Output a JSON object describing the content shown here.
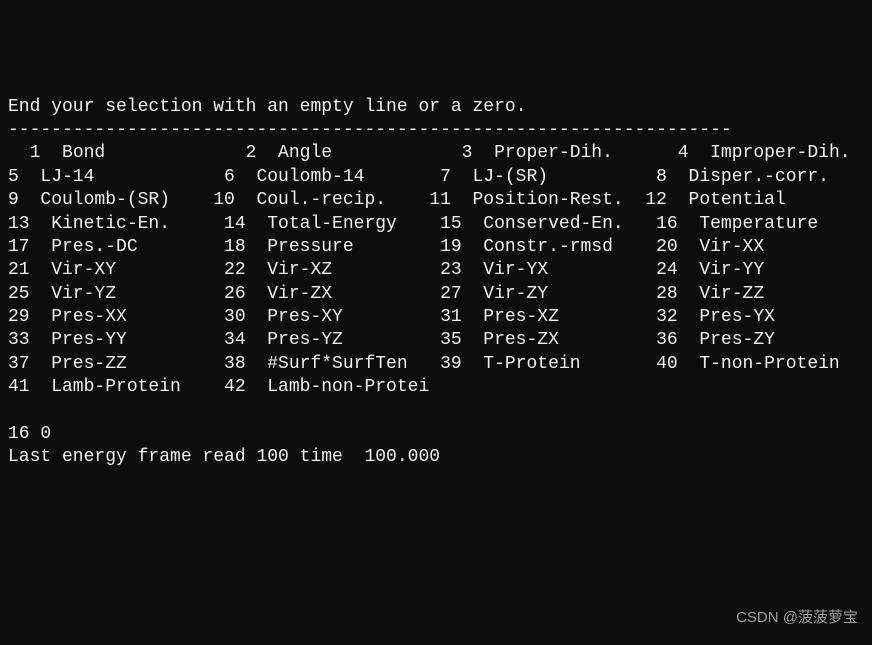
{
  "prompt": "End your selection with an empty line or a zero.",
  "separator": "-------------------------------------------------------------------",
  "options": [
    {
      "num": 1,
      "label": "Bond"
    },
    {
      "num": 2,
      "label": "Angle"
    },
    {
      "num": 3,
      "label": "Proper-Dih."
    },
    {
      "num": 4,
      "label": "Improper-Dih."
    },
    {
      "num": 5,
      "label": "LJ-14"
    },
    {
      "num": 6,
      "label": "Coulomb-14"
    },
    {
      "num": 7,
      "label": "LJ-(SR)"
    },
    {
      "num": 8,
      "label": "Disper.-corr."
    },
    {
      "num": 9,
      "label": "Coulomb-(SR)"
    },
    {
      "num": 10,
      "label": "Coul.-recip."
    },
    {
      "num": 11,
      "label": "Position-Rest."
    },
    {
      "num": 12,
      "label": "Potential"
    },
    {
      "num": 13,
      "label": "Kinetic-En."
    },
    {
      "num": 14,
      "label": "Total-Energy"
    },
    {
      "num": 15,
      "label": "Conserved-En."
    },
    {
      "num": 16,
      "label": "Temperature"
    },
    {
      "num": 17,
      "label": "Pres.-DC"
    },
    {
      "num": 18,
      "label": "Pressure"
    },
    {
      "num": 19,
      "label": "Constr.-rmsd"
    },
    {
      "num": 20,
      "label": "Vir-XX"
    },
    {
      "num": 21,
      "label": "Vir-XY"
    },
    {
      "num": 22,
      "label": "Vir-XZ"
    },
    {
      "num": 23,
      "label": "Vir-YX"
    },
    {
      "num": 24,
      "label": "Vir-YY"
    },
    {
      "num": 25,
      "label": "Vir-YZ"
    },
    {
      "num": 26,
      "label": "Vir-ZX"
    },
    {
      "num": 27,
      "label": "Vir-ZY"
    },
    {
      "num": 28,
      "label": "Vir-ZZ"
    },
    {
      "num": 29,
      "label": "Pres-XX"
    },
    {
      "num": 30,
      "label": "Pres-XY"
    },
    {
      "num": 31,
      "label": "Pres-XZ"
    },
    {
      "num": 32,
      "label": "Pres-YX"
    },
    {
      "num": 33,
      "label": "Pres-YY"
    },
    {
      "num": 34,
      "label": "Pres-YZ"
    },
    {
      "num": 35,
      "label": "Pres-ZX"
    },
    {
      "num": 36,
      "label": "Pres-ZY"
    },
    {
      "num": 37,
      "label": "Pres-ZZ"
    },
    {
      "num": 38,
      "label": "#Surf*SurfTen"
    },
    {
      "num": 39,
      "label": "T-Protein"
    },
    {
      "num": 40,
      "label": "T-non-Protein"
    },
    {
      "num": 41,
      "label": "Lamb-Protein"
    },
    {
      "num": 42,
      "label": "Lamb-non-Protein"
    }
  ],
  "input_line": "16 0",
  "status_line": "Last energy frame read 100 time  100.000",
  "watermark": "CSDN @菠菠萝宝",
  "columns_per_row": 4,
  "num_width": 3,
  "label_width": 15,
  "gap": "  "
}
